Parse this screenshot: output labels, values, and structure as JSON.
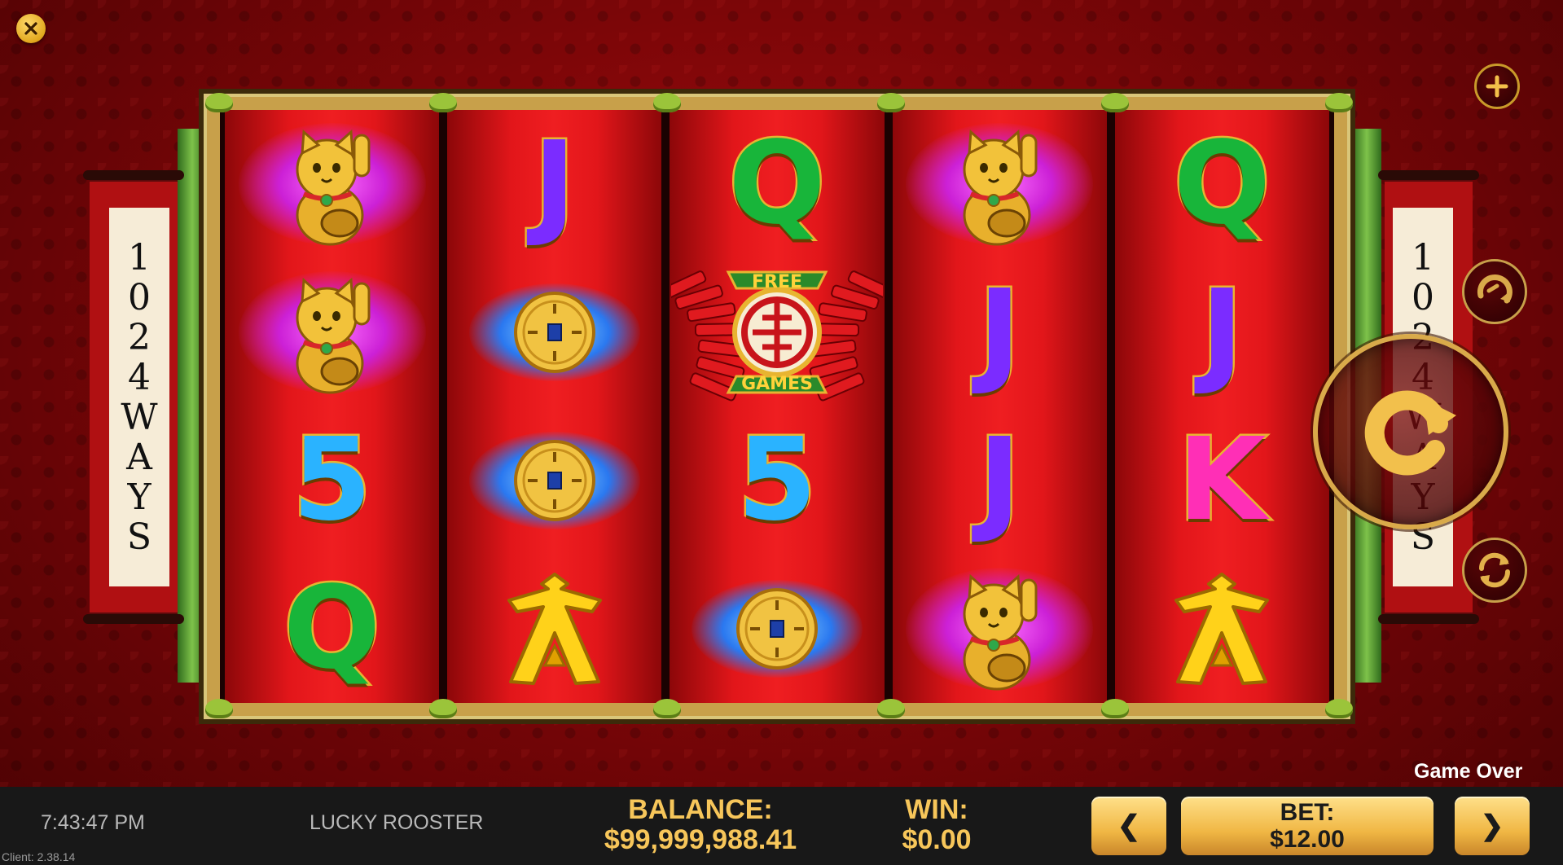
{
  "colors": {
    "gold": "#f7c65a",
    "reel_red": "#e2161a",
    "bar_bg": "#181818",
    "ace_yellow": "#ffd21a",
    "letter_j": "#7b2cff",
    "letter_q": "#18b53a",
    "letter_k": "#ff2fb6",
    "digit_5": "#2ab3ff"
  },
  "top_controls": {
    "close_icon": "close-icon",
    "add_icon": "plus-icon"
  },
  "side_controls": {
    "autoplay_icon": "autoplay-icon",
    "spin_icon": "spin-icon",
    "refresh_icon": "refresh-icon"
  },
  "scroll_left": {
    "chars": [
      "1",
      "0",
      "2",
      "4",
      "W",
      "A",
      "Y",
      "S"
    ]
  },
  "scroll_right": {
    "chars": [
      "1",
      "0",
      "2",
      "4",
      "W",
      "A",
      "Y",
      "S"
    ]
  },
  "reels": [
    {
      "symbols": [
        "cat",
        "cat",
        "5",
        "Q"
      ]
    },
    {
      "symbols": [
        "J",
        "coin",
        "coin",
        "ace"
      ]
    },
    {
      "symbols": [
        "Q",
        "free_games",
        "5",
        "coin"
      ]
    },
    {
      "symbols": [
        "cat",
        "J",
        "J",
        "cat"
      ]
    },
    {
      "symbols": [
        "Q",
        "J",
        "K",
        "ace"
      ]
    }
  ],
  "free_games_symbol": {
    "top_text": "FREE",
    "bottom_text": "GAMES"
  },
  "status": {
    "message": "Game Over"
  },
  "bottom_bar": {
    "clock": "7:43:47 PM",
    "game_name": "LUCKY ROOSTER",
    "client_version": "Client: 2.38.14",
    "balance_label": "BALANCE:",
    "balance_value": "$99,999,988.41",
    "win_label": "WIN:",
    "win_value": "$0.00",
    "bet_label": "BET:",
    "bet_value": "$12.00",
    "bet_down_icon": "chevron-left-icon",
    "bet_up_icon": "chevron-right-icon",
    "bet_down_glyph": "❮",
    "bet_up_glyph": "❯"
  }
}
